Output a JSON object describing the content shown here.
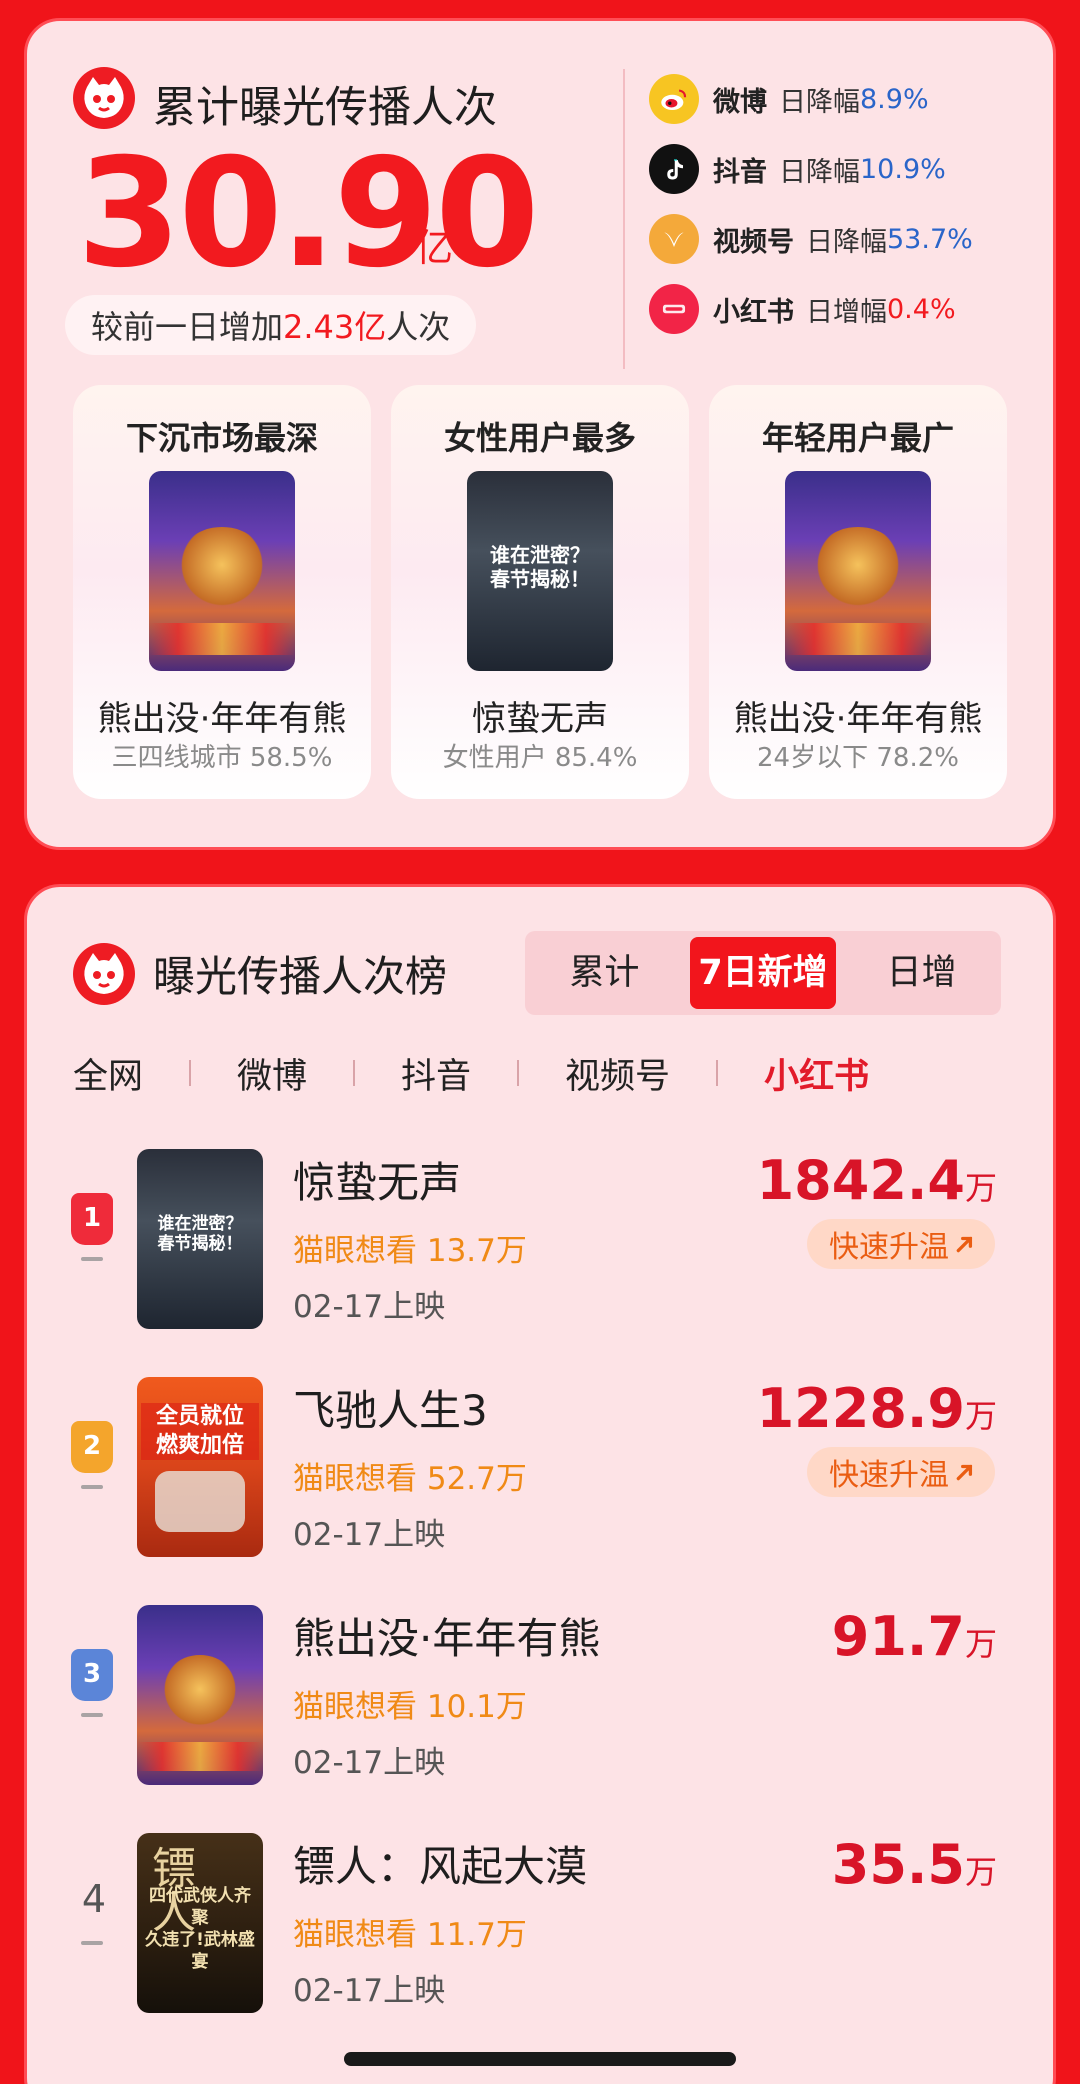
{
  "summary": {
    "title": "累计曝光传播人次",
    "total_value": "30.90",
    "total_unit": "亿",
    "increase_prefix": "较前一日增加",
    "increase_value": "2.43亿",
    "increase_suffix": "人次",
    "platforms": [
      {
        "name": "微博",
        "label": "日降幅",
        "value": "8.9%",
        "direction": "down",
        "icon": "weibo-icon",
        "color": "#f7c522"
      },
      {
        "name": "抖音",
        "label": "日降幅",
        "value": "10.9%",
        "direction": "down",
        "icon": "douyin-icon",
        "color": "#111111"
      },
      {
        "name": "视频号",
        "label": "日降幅",
        "value": "53.7%",
        "direction": "down",
        "icon": "channels-icon",
        "color": "#f4a93a"
      },
      {
        "name": "小红书",
        "label": "日增幅",
        "value": "0.4%",
        "direction": "up",
        "icon": "xiaohongshu-icon",
        "color": "#f22447"
      }
    ],
    "features": [
      {
        "title": "下沉市场最深",
        "film": "熊出没·年年有熊",
        "stat": "三四线城市 58.5%",
        "poster": "bear"
      },
      {
        "title": "女性用户最多",
        "film": "惊蛰无声",
        "stat": "女性用户 85.4%",
        "poster": "dark"
      },
      {
        "title": "年轻用户最广",
        "film": "熊出没·年年有熊",
        "stat": "24岁以下 78.2%",
        "poster": "bear"
      }
    ]
  },
  "ranking": {
    "title": "曝光传播人次榜",
    "segments": [
      "累计",
      "7日新增",
      "日增"
    ],
    "active_segment": "7日新增",
    "platform_tabs": [
      "全网",
      "微博",
      "抖音",
      "视频号",
      "小红书"
    ],
    "active_platform": "小红书",
    "items": [
      {
        "rank": "1",
        "name": "惊蛰无声",
        "want": "猫眼想看 13.7万",
        "release": "02-17上映",
        "exposure": "1842.4",
        "unit": "万",
        "trend": "快速升温"
      },
      {
        "rank": "2",
        "name": "飞驰人生3",
        "want": "猫眼想看 52.7万",
        "release": "02-17上映",
        "exposure": "1228.9",
        "unit": "万",
        "trend": "快速升温"
      },
      {
        "rank": "3",
        "name": "熊出没·年年有熊",
        "want": "猫眼想看 10.1万",
        "release": "02-17上映",
        "exposure": "91.7",
        "unit": "万",
        "trend": ""
      },
      {
        "rank": "4",
        "name": "镖人：风起大漠",
        "want": "猫眼想看 11.7万",
        "release": "02-17上映",
        "exposure": "35.5",
        "unit": "万",
        "trend": ""
      }
    ]
  },
  "posters": {
    "dark_text": "谁在泄密？\n春节揭秘！",
    "orange_text": "全员就位\n燃爽加倍",
    "brown_title": "镖人",
    "brown_text": "四代武侠人齐聚\n久违了!武林盛宴"
  },
  "colors": {
    "brand_red": "#f21a1f",
    "card_bg": "#fde3e6",
    "want_orange": "#f08a16",
    "decline_blue": "#2a65c9"
  }
}
